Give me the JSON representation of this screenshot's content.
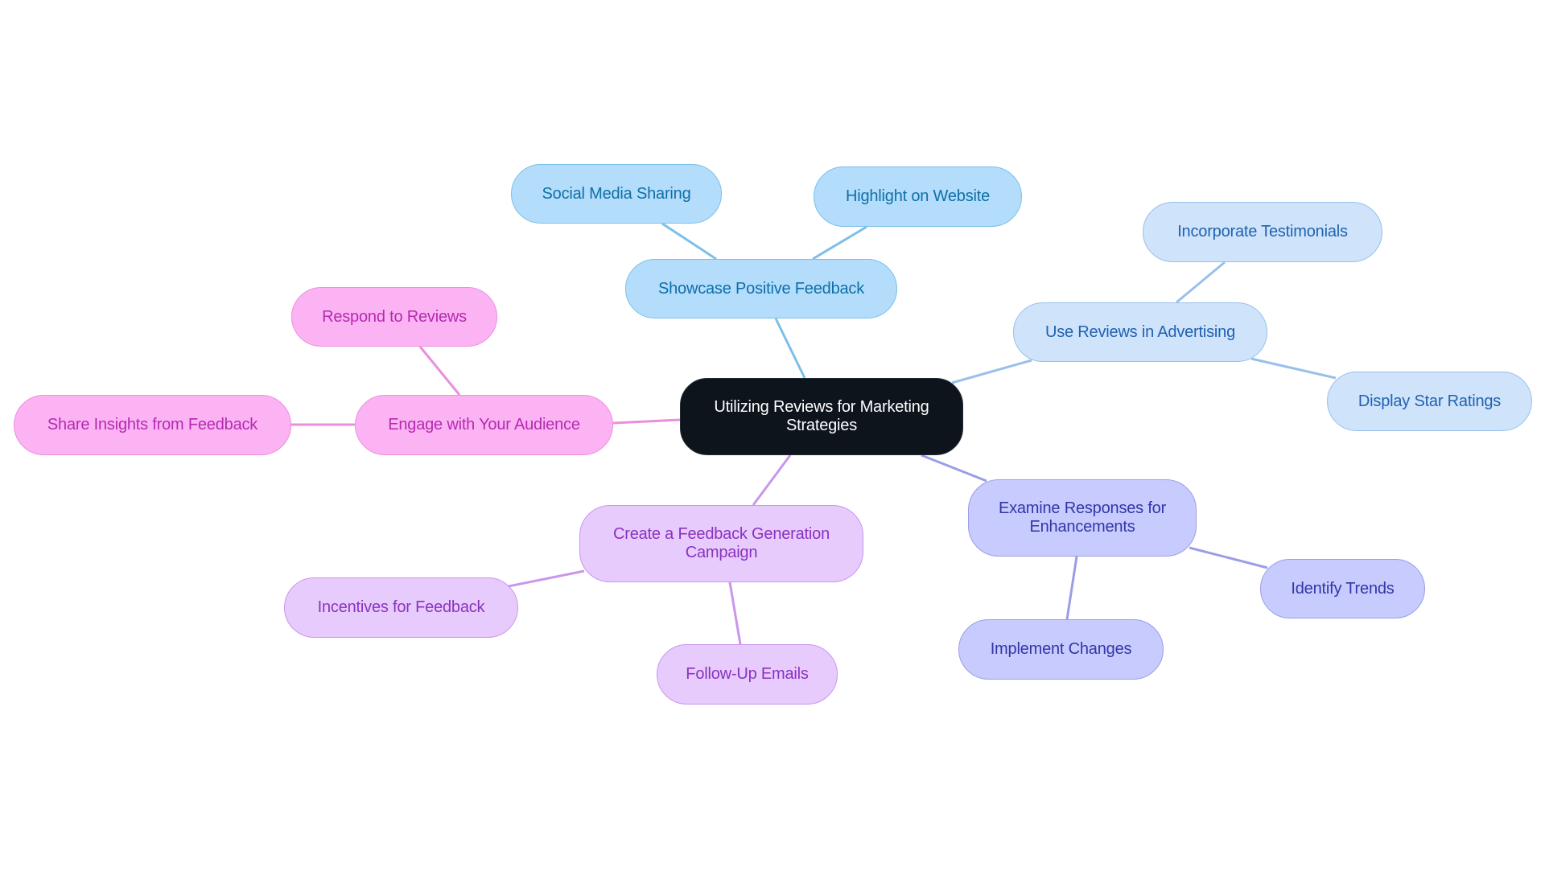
{
  "diagram": {
    "type": "mindmap",
    "root": {
      "id": "root",
      "label": "Utilizing Reviews for Marketing Strategies",
      "colors": {
        "fill": "#0d141c",
        "border": "#222b35",
        "text": "#ffffff"
      }
    },
    "branches": [
      {
        "id": "showcase",
        "label": "Showcase Positive Feedback",
        "colors": {
          "fill": "#b3ddfb",
          "border": "#7cbfe8",
          "text": "#0f6fa8",
          "edge": "#7cbfe8"
        },
        "children": [
          {
            "id": "social",
            "label": "Social Media Sharing"
          },
          {
            "id": "highlight",
            "label": "Highlight on Website"
          }
        ]
      },
      {
        "id": "advertising",
        "label": "Use Reviews in Advertising",
        "colors": {
          "fill": "#cfe3fb",
          "border": "#99c0eb",
          "text": "#1f62b0",
          "edge": "#99c0eb"
        },
        "children": [
          {
            "id": "testimonials",
            "label": "Incorporate Testimonials"
          },
          {
            "id": "stars",
            "label": "Display Star Ratings"
          }
        ]
      },
      {
        "id": "examine",
        "label": "Examine Responses for Enhancements",
        "colors": {
          "fill": "#c8cbfd",
          "border": "#9a9ee6",
          "text": "#3236a8",
          "edge": "#9a9ee6"
        },
        "children": [
          {
            "id": "trends",
            "label": "Identify Trends"
          },
          {
            "id": "implement",
            "label": "Implement Changes"
          }
        ]
      },
      {
        "id": "campaign",
        "label": "Create a Feedback Generation Campaign",
        "colors": {
          "fill": "#e8cbfd",
          "border": "#c996ec",
          "text": "#8a32c0",
          "edge": "#c996ec"
        },
        "children": [
          {
            "id": "incentives",
            "label": "Incentives for Feedback"
          },
          {
            "id": "followup",
            "label": "Follow-Up Emails"
          }
        ]
      },
      {
        "id": "engage",
        "label": "Engage with Your Audience",
        "colors": {
          "fill": "#fcb3f4",
          "border": "#ea8fdd",
          "text": "#b52ab0",
          "edge": "#ea8fdd"
        },
        "children": [
          {
            "id": "respond",
            "label": "Respond to Reviews"
          },
          {
            "id": "share",
            "label": "Share Insights from Feedback"
          }
        ]
      }
    ]
  }
}
